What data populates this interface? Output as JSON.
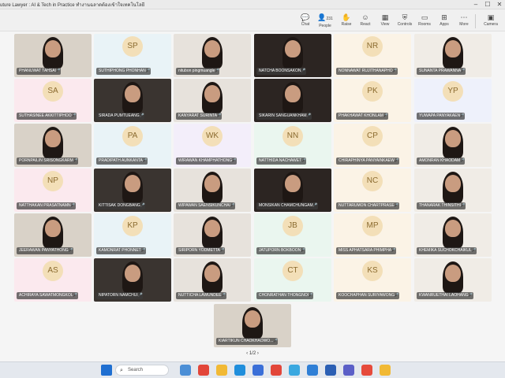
{
  "window": {
    "title": "uture Lawyer : AI & Tech in Practice ทำงานฉลาดต้องเข้าใจเทคโนโลยี",
    "controls": {
      "minimize": "–",
      "maximize": "☐",
      "close": "✕"
    }
  },
  "toolbar": {
    "people_count": "231",
    "items": [
      {
        "key": "chat",
        "label": "Chat",
        "icon": "chat-icon",
        "glyph": "💬"
      },
      {
        "key": "people",
        "label": "People",
        "icon": "people-icon",
        "glyph": "👤"
      },
      {
        "key": "raise",
        "label": "Raise",
        "icon": "hand-icon",
        "glyph": "✋"
      },
      {
        "key": "react",
        "label": "React",
        "icon": "smile-icon",
        "glyph": "☺"
      },
      {
        "key": "view",
        "label": "View",
        "icon": "grid-icon",
        "glyph": "▦"
      },
      {
        "key": "controls",
        "label": "Controls",
        "icon": "shield-icon",
        "glyph": "⛨"
      },
      {
        "key": "rooms",
        "label": "Rooms",
        "icon": "rooms-icon",
        "glyph": "▭"
      },
      {
        "key": "apps",
        "label": "Apps",
        "icon": "apps-icon",
        "glyph": "⊞"
      },
      {
        "key": "more",
        "label": "More",
        "icon": "ellipsis-icon",
        "glyph": "⋯"
      },
      {
        "key": "camera",
        "label": "Camera",
        "icon": "camera-icon",
        "glyph": "▣"
      }
    ]
  },
  "participants": [
    {
      "name": "PHANUWAT TAHSAI",
      "initials": "",
      "video": true
    },
    {
      "name": "SUTHIPHONG PHONHAN",
      "initials": "SP",
      "video": false
    },
    {
      "name": "nitubon pingmuangle",
      "initials": "",
      "video": true
    },
    {
      "name": "NATCHA BOONSAKON",
      "initials": "",
      "video": true
    },
    {
      "name": "NONNAWAT RUJITHANAPHO",
      "initials": "NR",
      "video": false
    },
    {
      "name": "SUNANTA PRAWANNA",
      "initials": "",
      "video": true
    },
    {
      "name": "SUTHASINEE AKKITTIPHOO",
      "initials": "SA",
      "video": false
    },
    {
      "name": "SIRADA PUMTUEANG",
      "initials": "",
      "video": true
    },
    {
      "name": "KANYARAT SURINTA",
      "initials": "",
      "video": true
    },
    {
      "name": "SIKARIN SANGUANKHAM",
      "initials": "",
      "video": true
    },
    {
      "name": "PHAKHAWAT KHONLAM",
      "initials": "PK",
      "video": false
    },
    {
      "name": "YUWAPA PANYAKAEN",
      "initials": "YP",
      "video": false
    },
    {
      "name": "PORNPAILIN SRISONGKARM",
      "initials": "",
      "video": true
    },
    {
      "name": "PRADIPATH AUNKANTA",
      "initials": "PA",
      "video": false
    },
    {
      "name": "WIRAWAN KHAMPHATHONG",
      "initials": "WK",
      "video": false
    },
    {
      "name": "NATTHIDA NACHAWET",
      "initials": "NN",
      "video": false
    },
    {
      "name": "CHIRAPHINYA PANYAINKAEW",
      "initials": "CP",
      "video": false
    },
    {
      "name": "AMONRAN KHAODAM",
      "initials": "",
      "video": true
    },
    {
      "name": "NATTHAKAN PRASATNAMN",
      "initials": "NP",
      "video": false
    },
    {
      "name": "KITTISAK DONGBANG",
      "initials": "",
      "video": true
    },
    {
      "name": "WIPAWAN SAENSIKUNCHAI",
      "initials": "",
      "video": true
    },
    {
      "name": "MONSIKAN CHAMCHUNGAM",
      "initials": "",
      "video": true
    },
    {
      "name": "NUTTARUMON CHARTPRASE",
      "initials": "NC",
      "video": false
    },
    {
      "name": "THANARAK THINSITHI",
      "initials": "",
      "video": true
    },
    {
      "name": "JEERAWAN PANYATHONG",
      "initials": "",
      "video": true
    },
    {
      "name": "KAMONRAT PHONNET",
      "initials": "KP",
      "video": false
    },
    {
      "name": "SIRIPORN YODMETTA",
      "initials": "",
      "video": true
    },
    {
      "name": "JATUPORN BOKBOON",
      "initials": "JB",
      "video": false
    },
    {
      "name": "MISS APHATSARA PHIMPHA",
      "initials": "MP",
      "video": false
    },
    {
      "name": "KHEMIKA SUCHOKCHAIKUL",
      "initials": "",
      "video": true
    },
    {
      "name": "ACHIRAYA SAWATMONGKOL",
      "initials": "AS",
      "video": false
    },
    {
      "name": "NIPATORN NAMCHUI",
      "initials": "",
      "video": true
    },
    {
      "name": "NUTTICHA LAWUNDEE",
      "initials": "",
      "video": true
    },
    {
      "name": "CHONRATHAN THONGNOI",
      "initials": "CT",
      "video": false
    },
    {
      "name": "KOOCHAPHAN SURIYAWONG",
      "initials": "KS",
      "video": false
    },
    {
      "name": "KWANRUETHAI LAOHANG",
      "initials": "",
      "video": true
    },
    {
      "name": "KIARTIKUN CHAOKHAOWO...",
      "initials": "",
      "video": true
    }
  ],
  "pager": {
    "text": "1/2",
    "prev": "‹",
    "next": "›"
  },
  "taskbar": {
    "search_label": "Search",
    "start_icon": "windows-icon",
    "apps": [
      "widgets-icon",
      "chrome-icon",
      "folder-icon",
      "edge-icon",
      "store-icon",
      "chrome-icon",
      "photos-icon",
      "onedrive-icon",
      "word-icon",
      "teams-icon",
      "calendar-icon",
      "chrome-icon"
    ]
  },
  "colors": {
    "tile_bg": "#ffffff",
    "avatar_bg": "#f3dfb8",
    "avatar_text": "#8a6a2e",
    "nametag_bg": "#3c3c3c",
    "taskbar_bg": "#e4e8ee"
  }
}
